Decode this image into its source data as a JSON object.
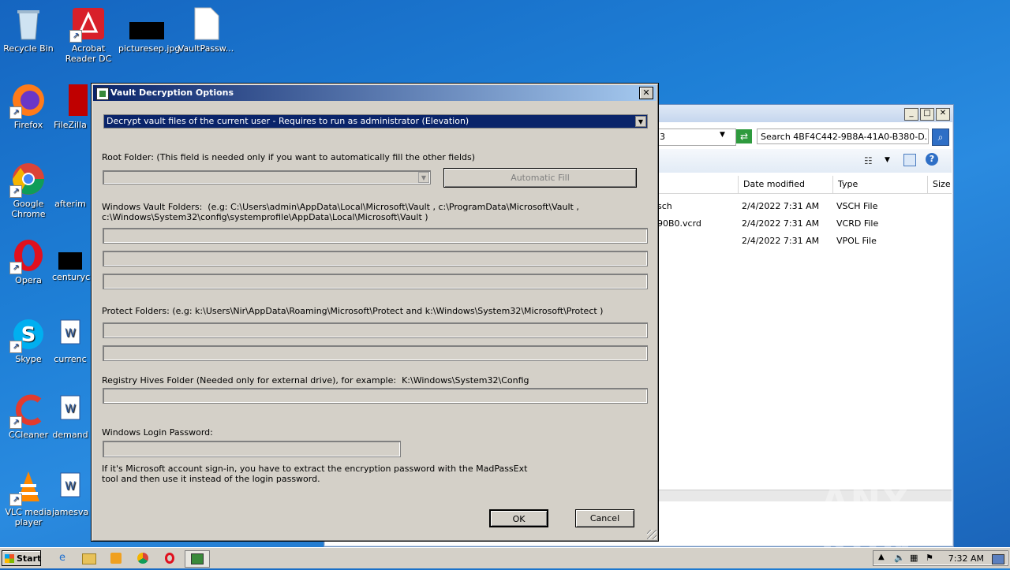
{
  "desktop": {
    "icons": [
      {
        "label": "Recycle Bin",
        "icon": "recycle-bin-icon"
      },
      {
        "label": "Acrobat Reader DC",
        "icon": "acrobat-icon"
      },
      {
        "label": "picturesep.jpg",
        "icon": "image-file-icon"
      },
      {
        "label": "VaultPassw...",
        "icon": "file-icon"
      },
      {
        "label": "Firefox",
        "icon": "firefox-icon"
      },
      {
        "label": "FileZilla",
        "icon": "filezilla-icon"
      },
      {
        "label": "Google Chrome",
        "icon": "chrome-icon"
      },
      {
        "label": "afterim",
        "icon": "file-icon"
      },
      {
        "label": "Opera",
        "icon": "opera-icon"
      },
      {
        "label": "centuryc",
        "icon": "file-icon"
      },
      {
        "label": "Skype",
        "icon": "skype-icon"
      },
      {
        "label": "currenc",
        "icon": "word-doc-icon"
      },
      {
        "label": "CCleaner",
        "icon": "ccleaner-icon"
      },
      {
        "label": "demand",
        "icon": "word-doc-icon"
      },
      {
        "label": "VLC media player",
        "icon": "vlc-icon"
      },
      {
        "label": "jamesva",
        "icon": "word-doc-icon"
      }
    ]
  },
  "explorer": {
    "address_fragment": "3",
    "search_placeholder": "Search 4BF4C442-9B8A-41A0-B380-D...",
    "columns": [
      "Date modified",
      "Type",
      "Size"
    ],
    "rows": [
      {
        "name": "sch",
        "date": "2/4/2022 7:31 AM",
        "type": "VSCH File"
      },
      {
        "name": "90B0.vcrd",
        "date": "2/4/2022 7:31 AM",
        "type": "VCRD File"
      },
      {
        "name": "",
        "date": "2/4/2022 7:31 AM",
        "type": "VPOL File"
      }
    ]
  },
  "dialog": {
    "title": "Vault Decryption Options",
    "mode_value": "Decrypt vault files of the current user - Requires to run as administrator (Elevation)",
    "root_label": "Root Folder: (This field is needed only if you want to automatically fill the other fields)",
    "auto_fill_label": "Automatic Fill",
    "vault_label_1": "Windows Vault Folders:  (e.g: C:\\Users\\admin\\AppData\\Local\\Microsoft\\Vault , c:\\ProgramData\\Microsoft\\Vault ,",
    "vault_label_2": "c:\\Windows\\System32\\config\\systemprofile\\AppData\\Local\\Microsoft\\Vault )",
    "protect_label": "Protect Folders: (e.g: k:\\Users\\Nir\\AppData\\Roaming\\Microsoft\\Protect and k:\\Windows\\System32\\Microsoft\\Protect )",
    "registry_label": "Registry Hives Folder (Needed only for external drive), for example:  K:\\Windows\\System32\\Config",
    "password_label": "Windows Login Password:",
    "note_1": "If it's Microsoft account sign-in, you have to extract the encryption password with the MadPassExt",
    "note_2": "tool and then use it instead of the login password.",
    "ok_label": "OK",
    "cancel_label": "Cancel"
  },
  "taskbar": {
    "start_label": "Start",
    "clock": "7:32 AM"
  },
  "watermark": "ANY RUN"
}
